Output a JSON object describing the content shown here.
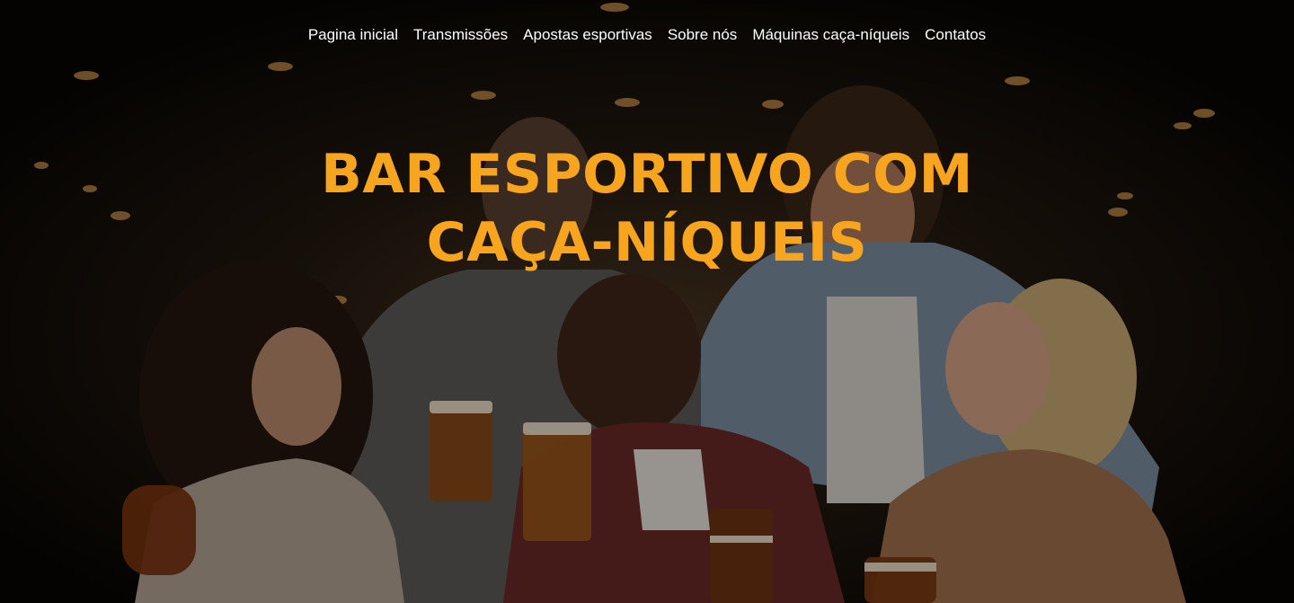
{
  "nav": {
    "items": [
      {
        "label": "Pagina inicial"
      },
      {
        "label": "Transmissões"
      },
      {
        "label": "Apostas esportivas"
      },
      {
        "label": "Sobre nós"
      },
      {
        "label": "Máquinas caça-níqueis"
      },
      {
        "label": "Contatos"
      }
    ]
  },
  "hero": {
    "title_line1": "BAR ESPORTIVO COM",
    "title_line2": "CAÇA-NÍQUEIS"
  },
  "colors": {
    "accent": "#f7a51e",
    "nav_text": "#ffffff",
    "background": "#0b0907"
  }
}
